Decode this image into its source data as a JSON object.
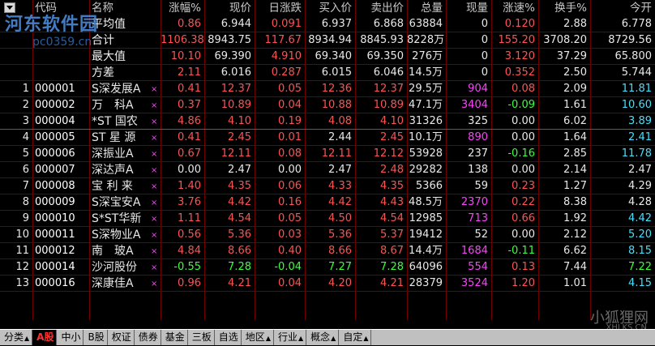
{
  "header": [
    "",
    "代码",
    "名称",
    "涨幅%",
    "现价",
    "日涨跌",
    "买入价",
    "卖出价",
    "总量",
    "现量",
    "涨速%",
    "换手%",
    "今开"
  ],
  "stats": [
    {
      "label": "平均值",
      "cols": [
        "0.86",
        "6.944",
        "0.091",
        "6.937",
        "6.868",
        "63884",
        "0",
        "0.120",
        "2.88",
        "6.778"
      ]
    },
    {
      "label": "合计",
      "cols": [
        "1106.38",
        "8943.75",
        "117.67",
        "8934.94",
        "8845.93",
        "8228万",
        "0",
        "155.20",
        "3708.20",
        "8729.56"
      ]
    },
    {
      "label": "最大值",
      "cols": [
        "10.10",
        "69.390",
        "4.910",
        "69.340",
        "69.350",
        "276万",
        "0",
        "3.120",
        "37.29",
        "65.800"
      ]
    },
    {
      "label": "方差",
      "cols": [
        "2.11",
        "6.016",
        "0.287",
        "6.015",
        "6.046",
        "14.5万",
        "0",
        "0.352",
        "2.50",
        "5.744"
      ]
    }
  ],
  "rows": [
    {
      "n": "1",
      "code": "000001",
      "name": "S深发展A",
      "cols": [
        "0.41",
        "12.37",
        "0.05",
        "12.36",
        "12.37",
        "29.5万",
        "904",
        "0.08",
        "2.09",
        "11.81"
      ],
      "c": [
        "r",
        "r",
        "r",
        "r",
        "r",
        "w",
        "m",
        "r",
        "w",
        "c"
      ]
    },
    {
      "n": "2",
      "code": "000002",
      "name": "万　科A",
      "cols": [
        "0.37",
        "10.89",
        "0.04",
        "10.88",
        "10.89",
        "47.1万",
        "3404",
        "-0.09",
        "1.61",
        "10.60"
      ],
      "c": [
        "r",
        "r",
        "r",
        "r",
        "r",
        "w",
        "m",
        "g",
        "w",
        "c"
      ]
    },
    {
      "n": "3",
      "code": "000004",
      "name": "*ST 国农",
      "cols": [
        "4.86",
        "4.10",
        "0.19",
        "4.08",
        "4.10",
        "31326",
        "325",
        "0.00",
        "6.02",
        "3.89"
      ],
      "c": [
        "r",
        "r",
        "r",
        "r",
        "r",
        "w",
        "w",
        "w",
        "w",
        "c"
      ]
    },
    {
      "n": "4",
      "code": "000005",
      "name": "ST 星 源",
      "cols": [
        "0.41",
        "2.45",
        "0.01",
        "2.44",
        "2.45",
        "10.1万",
        "890",
        "0.00",
        "1.64",
        "2.41"
      ],
      "c": [
        "r",
        "r",
        "r",
        "w",
        "r",
        "w",
        "m",
        "w",
        "w",
        "c"
      ]
    },
    {
      "n": "5",
      "code": "000006",
      "name": "深振业A",
      "cols": [
        "0.67",
        "12.11",
        "0.08",
        "12.11",
        "12.12",
        "53928",
        "237",
        "-0.16",
        "2.85",
        "11.78"
      ],
      "c": [
        "r",
        "r",
        "r",
        "r",
        "r",
        "w",
        "w",
        "g",
        "w",
        "c"
      ]
    },
    {
      "n": "6",
      "code": "000007",
      "name": "深达声A",
      "cols": [
        "0.00",
        "2.47",
        "0.00",
        "2.47",
        "2.48",
        "29282",
        "138",
        "0.00",
        "2.14",
        "2.47"
      ],
      "c": [
        "w",
        "w",
        "w",
        "w",
        "r",
        "w",
        "w",
        "w",
        "w",
        "w"
      ]
    },
    {
      "n": "7",
      "code": "000008",
      "name": "宝 利 来",
      "cols": [
        "1.40",
        "4.35",
        "0.06",
        "4.33",
        "4.35",
        "5366",
        "59",
        "0.23",
        "1.27",
        "4.29"
      ],
      "c": [
        "r",
        "r",
        "r",
        "r",
        "r",
        "w",
        "w",
        "r",
        "w",
        "w"
      ]
    },
    {
      "n": "8",
      "code": "000009",
      "name": "S深宝安A",
      "cols": [
        "3.76",
        "4.42",
        "0.16",
        "4.42",
        "4.43",
        "48.5万",
        "2370",
        "0.22",
        "8.38",
        "4.28"
      ],
      "c": [
        "r",
        "r",
        "r",
        "r",
        "r",
        "w",
        "m",
        "r",
        "w",
        "w"
      ]
    },
    {
      "n": "9",
      "code": "000010",
      "name": "S*ST华新",
      "cols": [
        "1.11",
        "4.54",
        "0.05",
        "4.50",
        "4.54",
        "12985",
        "713",
        "0.66",
        "1.92",
        "4.42"
      ],
      "c": [
        "r",
        "r",
        "r",
        "r",
        "r",
        "w",
        "m",
        "r",
        "w",
        "c"
      ]
    },
    {
      "n": "10",
      "code": "000011",
      "name": "S深物业A",
      "cols": [
        "0.56",
        "5.36",
        "0.03",
        "5.36",
        "5.37",
        "19412",
        "52",
        "0.00",
        "2.12",
        "5.20"
      ],
      "c": [
        "r",
        "r",
        "r",
        "r",
        "r",
        "w",
        "w",
        "w",
        "w",
        "c"
      ]
    },
    {
      "n": "11",
      "code": "000012",
      "name": "南　玻A",
      "cols": [
        "4.84",
        "8.66",
        "0.40",
        "8.66",
        "8.67",
        "14.4万",
        "1684",
        "-0.11",
        "6.62",
        "8.15"
      ],
      "c": [
        "r",
        "r",
        "r",
        "r",
        "r",
        "w",
        "m",
        "g",
        "w",
        "c"
      ]
    },
    {
      "n": "12",
      "code": "000014",
      "name": "沙河股份",
      "cols": [
        "-0.55",
        "7.28",
        "-0.04",
        "7.27",
        "7.28",
        "64096",
        "554",
        "0.13",
        "7.44",
        "7.22"
      ],
      "c": [
        "g",
        "g",
        "g",
        "g",
        "g",
        "w",
        "m",
        "r",
        "w",
        "g"
      ]
    },
    {
      "n": "13",
      "code": "000016",
      "name": "深康佳A",
      "cols": [
        "0.96",
        "4.21",
        "0.04",
        "4.20",
        "4.21",
        "28379",
        "3524",
        "1.20",
        "1.01",
        "4.15"
      ],
      "c": [
        "r",
        "r",
        "r",
        "r",
        "r",
        "w",
        "m",
        "r",
        "w",
        "c"
      ]
    }
  ],
  "mark_symbol": "×",
  "tabs": [
    {
      "label": "分类",
      "arrow": true
    },
    {
      "label": "A股",
      "arrow": false,
      "active": true
    },
    {
      "label": "中小",
      "arrow": false
    },
    {
      "label": "B股",
      "arrow": false
    },
    {
      "label": "权证",
      "arrow": false
    },
    {
      "label": "债券",
      "arrow": false
    },
    {
      "label": "基金",
      "arrow": false
    },
    {
      "label": "三板",
      "arrow": false
    },
    {
      "label": "自选",
      "arrow": false
    },
    {
      "label": "地区",
      "arrow": true
    },
    {
      "label": "行业",
      "arrow": true
    },
    {
      "label": "概念",
      "arrow": true
    },
    {
      "label": "自定",
      "arrow": true
    }
  ],
  "tab_arrow": "▲",
  "watermarks": {
    "top": "河东软件园",
    "top_url": "pc0359.cn",
    "bottom": "小狐狸网",
    "bottom_url": "XHLKS.CN"
  },
  "colors": {
    "red": "#ff5252",
    "green": "#3aff3a",
    "white": "#e8e8e8",
    "magenta": "#ff40ff",
    "cyan": "#40e0ff",
    "yellow": "#ffff40",
    "stat_label": "#f0f0f0",
    "code": "#ffffff"
  }
}
